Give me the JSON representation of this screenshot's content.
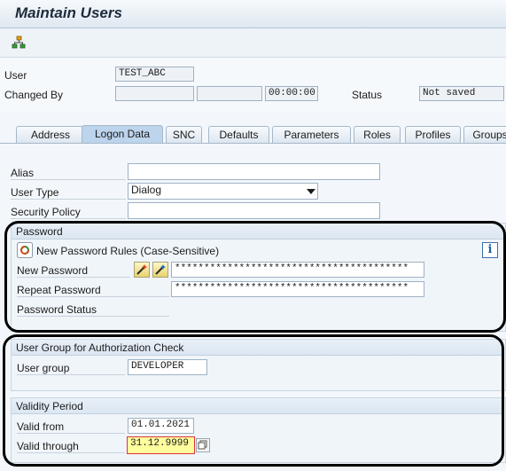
{
  "window": {
    "title": "Maintain Users"
  },
  "toolbar": {
    "icon": "hierarchy-icon"
  },
  "header": {
    "user_label": "User",
    "user_value": "TEST_ABC",
    "changed_by_label": "Changed By",
    "changed_by_value": "",
    "changed_date_value": "",
    "changed_time_value": "00:00:00",
    "status_label": "Status",
    "status_value": "Not saved"
  },
  "tabs": [
    {
      "label": "Address"
    },
    {
      "label": "Logon Data"
    },
    {
      "label": "SNC"
    },
    {
      "label": "Defaults"
    },
    {
      "label": "Parameters"
    },
    {
      "label": "Roles"
    },
    {
      "label": "Profiles"
    },
    {
      "label": "Groups"
    }
  ],
  "active_tab": "Logon Data",
  "logon": {
    "alias_label": "Alias",
    "alias_value": "",
    "user_type_label": "User Type",
    "user_type_value": "Dialog",
    "security_policy_label": "Security Policy",
    "security_policy_value": ""
  },
  "password": {
    "section_title": "Password",
    "rules_label": "New Password Rules (Case-Sensitive)",
    "new_password_label": "New Password",
    "new_password_value": "****************************************",
    "repeat_password_label": "Repeat Password",
    "repeat_password_value": "****************************************",
    "status_label": "Password Status"
  },
  "auth_group": {
    "section_title": "User Group for Authorization Check",
    "user_group_label": "User group",
    "user_group_value": "DEVELOPER"
  },
  "validity": {
    "section_title": "Validity Period",
    "valid_from_label": "Valid from",
    "valid_from_value": "01.01.2021",
    "valid_through_label": "Valid through",
    "valid_through_value": "31.12.9999"
  },
  "colors": {
    "accent": "#bcd4ec",
    "highlight_field": "#ffff9e",
    "highlight_border": "#e0323a"
  }
}
